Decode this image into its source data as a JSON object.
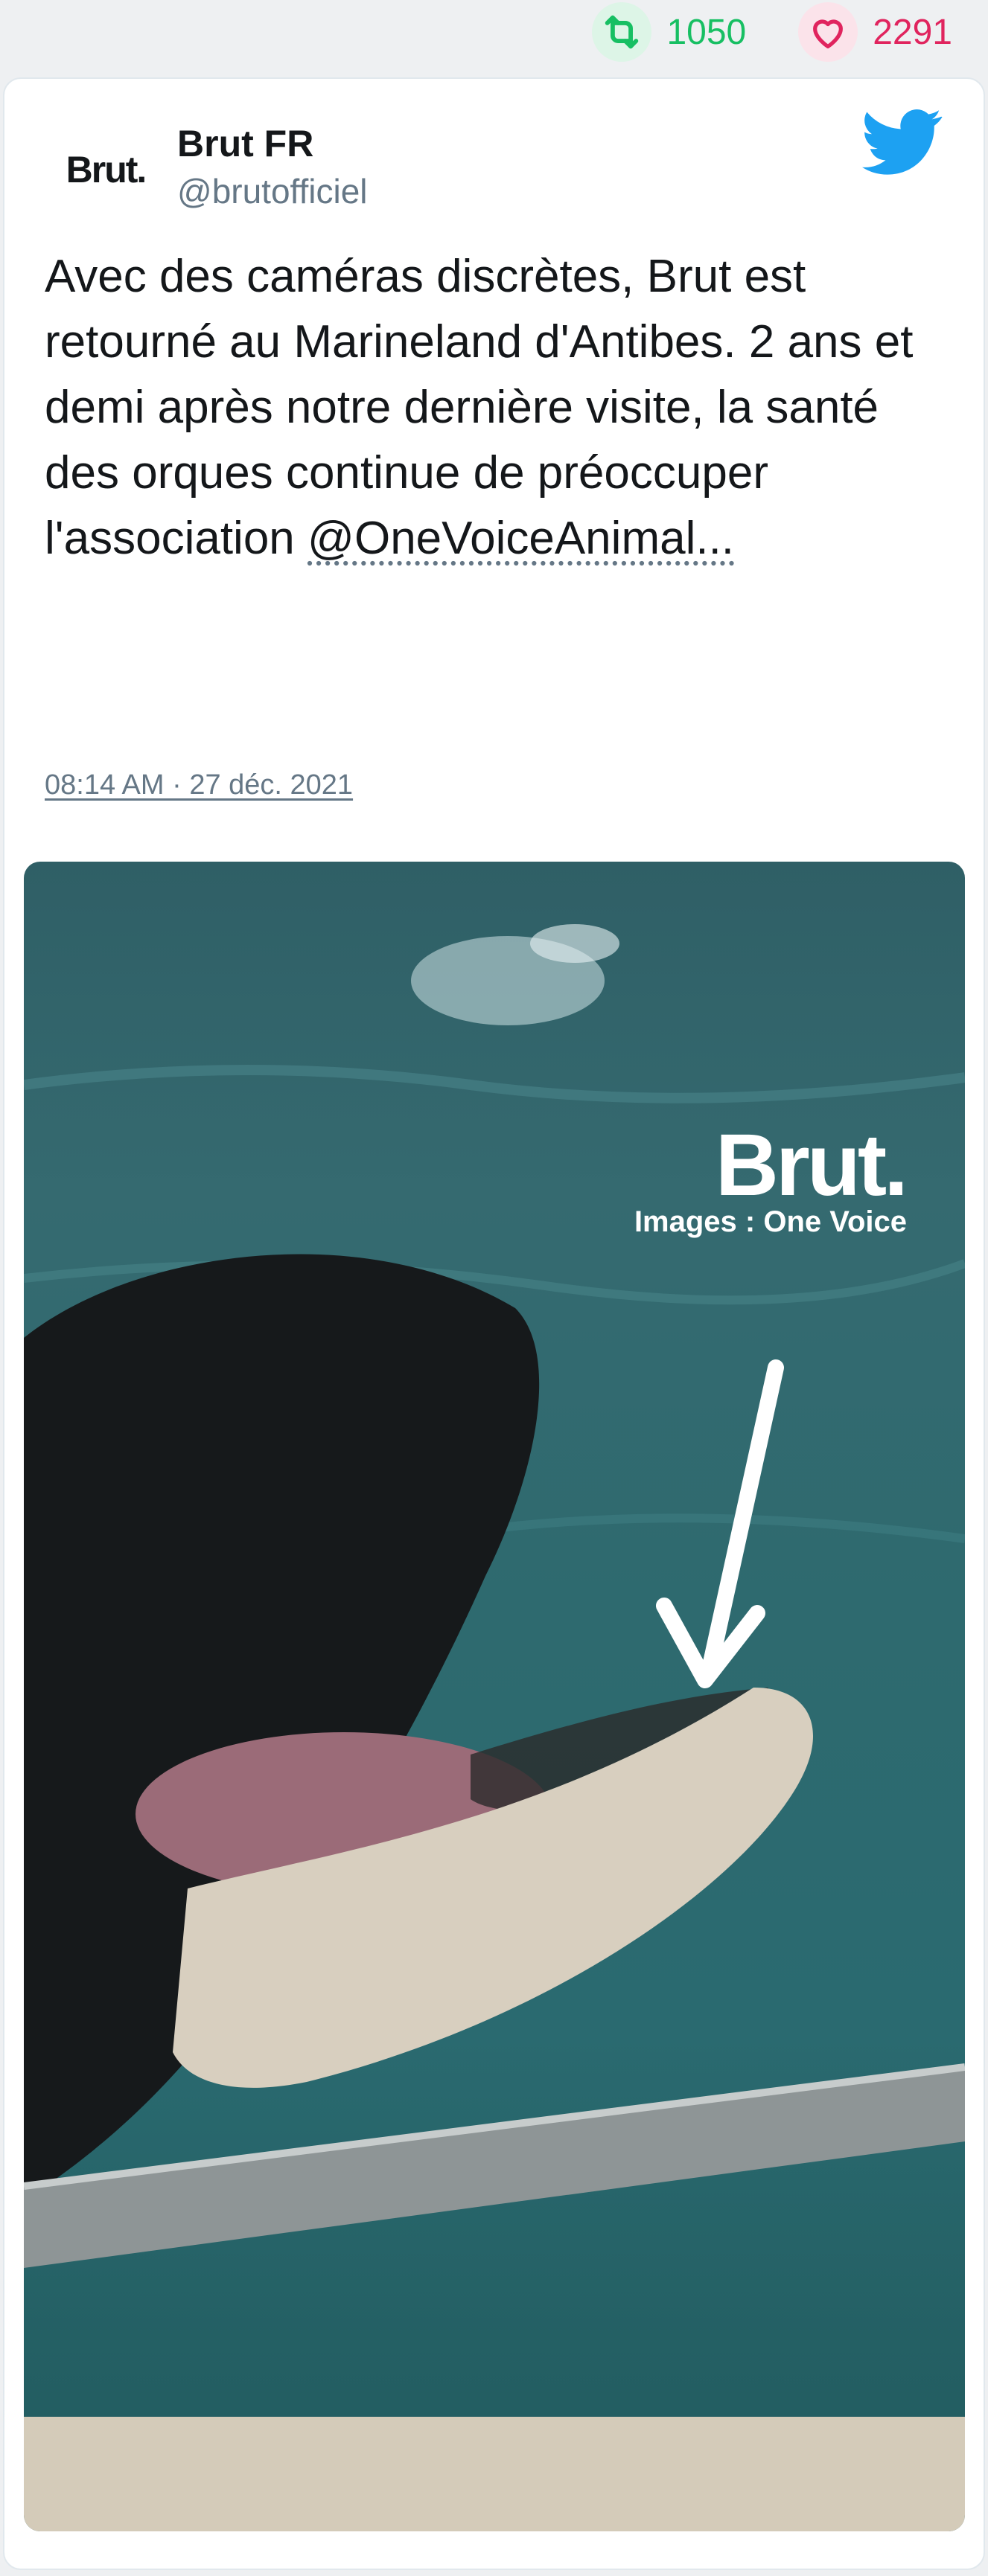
{
  "stats": {
    "retweets": "1050",
    "likes": "2291",
    "retweet_color": "#17bf63",
    "like_color": "#e0245e"
  },
  "tweet": {
    "avatar_text": "Brut.",
    "author_name": "Brut FR",
    "author_handle": "@brutofficiel",
    "text": "Avec des caméras discrètes, Brut est retourné au Marineland d'Antibes. 2 ans et demi après notre dernière visite, la santé des orques continue de préoccuper l'association ",
    "mention": "@OneVoiceAnimal...",
    "timestamp": "08:14 AM · 27 déc. 2021"
  },
  "actions": {
    "reply_icon": "reply-icon",
    "retweet_icon": "retweet-icon",
    "like_icon": "heart-icon"
  },
  "media": {
    "brand": "Brut.",
    "credit": "Images : One Voice"
  },
  "brand_color": "#1da1f2"
}
